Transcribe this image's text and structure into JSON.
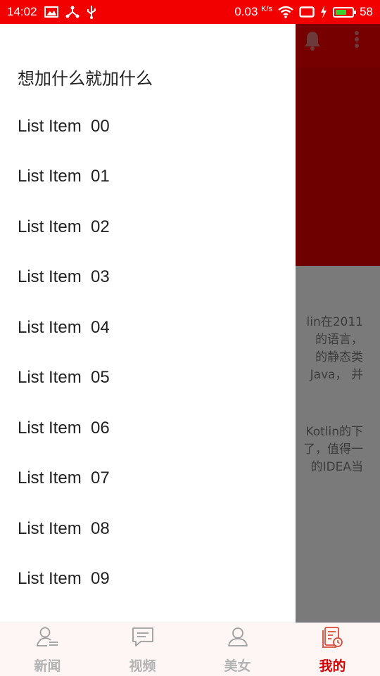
{
  "status_bar": {
    "time": "14:02",
    "network_speed": "0.03",
    "network_unit": "K/s",
    "battery_level": "58",
    "icons": [
      "gallery-icon",
      "usb-share-icon",
      "usb-icon",
      "wifi-icon",
      "screen-icon",
      "charging-icon",
      "battery-icon"
    ]
  },
  "background": {
    "toolbar_icons": [
      "bell-icon",
      "more-vert-icon"
    ],
    "paragraph_1": "lin在2011\n的语言，\n的静态类\nJava， 并",
    "paragraph_2": "Kotlin的下\n了，值得一\n的IDEA当"
  },
  "drawer": {
    "header": "想加什么就加什么",
    "items": [
      {
        "label": "List Item",
        "number": "00"
      },
      {
        "label": "List Item",
        "number": "01"
      },
      {
        "label": "List Item",
        "number": "02"
      },
      {
        "label": "List Item",
        "number": "03"
      },
      {
        "label": "List Item",
        "number": "04"
      },
      {
        "label": "List Item",
        "number": "05"
      },
      {
        "label": "List Item",
        "number": "06"
      },
      {
        "label": "List Item",
        "number": "07"
      },
      {
        "label": "List Item",
        "number": "08"
      },
      {
        "label": "List Item",
        "number": "09"
      }
    ]
  },
  "bottom_nav": {
    "tabs": [
      {
        "label": "新闻",
        "icon": "news-person-icon",
        "active": false
      },
      {
        "label": "视频",
        "icon": "chat-bubble-icon",
        "active": false
      },
      {
        "label": "美女",
        "icon": "person-icon",
        "active": false
      },
      {
        "label": "我的",
        "icon": "profile-doc-icon",
        "active": true
      }
    ],
    "colors": {
      "active": "#d40000",
      "inactive": "#b3b3b3"
    }
  },
  "colors": {
    "status_bar": "#f20000",
    "toolbar": "#760000",
    "overlay_content": "#7a7a7a"
  }
}
